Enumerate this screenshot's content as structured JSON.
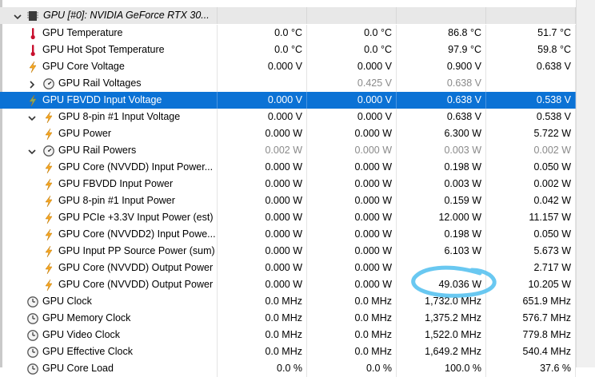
{
  "group_header": {
    "label": "GPU [#0]: NVIDIA GeForce RTX 30..."
  },
  "rows": [
    {
      "label": "GPU Temperature",
      "icon": "thermometer-icon",
      "v": [
        "0.0 °C",
        "0.0 °C",
        "86.8 °C",
        "51.7 °C"
      ]
    },
    {
      "label": "GPU Hot Spot Temperature",
      "icon": "thermometer-icon",
      "v": [
        "0.0 °C",
        "0.0 °C",
        "97.9 °C",
        "59.8 °C"
      ]
    },
    {
      "label": "GPU Core Voltage",
      "icon": "bolt-icon",
      "v": [
        "0.000 V",
        "0.000 V",
        "0.900 V",
        "0.638 V"
      ]
    },
    {
      "label": "GPU Rail Voltages",
      "icon": "gauge-icon",
      "v": [
        "",
        "0.425 V",
        "0.638 V",
        ""
      ]
    },
    {
      "label": "GPU FBVDD Input Voltage",
      "icon": "bolt-icon",
      "v": [
        "0.000 V",
        "0.000 V",
        "0.638 V",
        "0.538 V"
      ]
    },
    {
      "label": "GPU 8-pin #1 Input Voltage",
      "icon": "bolt-icon",
      "v": [
        "0.000 V",
        "0.000 V",
        "0.638 V",
        "0.538 V"
      ]
    },
    {
      "label": "GPU Power",
      "icon": "bolt-icon",
      "v": [
        "0.000 W",
        "0.000 W",
        "6.300 W",
        "5.722 W"
      ]
    },
    {
      "label": "GPU Rail Powers",
      "icon": "gauge-icon",
      "v": [
        "0.002 W",
        "0.000 W",
        "0.003 W",
        "0.002 W"
      ]
    },
    {
      "label": "GPU Core (NVVDD) Input Power...",
      "icon": "bolt-icon",
      "v": [
        "0.000 W",
        "0.000 W",
        "0.198 W",
        "0.050 W"
      ]
    },
    {
      "label": "GPU FBVDD Input Power",
      "icon": "bolt-icon",
      "v": [
        "0.000 W",
        "0.000 W",
        "0.003 W",
        "0.002 W"
      ]
    },
    {
      "label": "GPU 8-pin #1 Input Power",
      "icon": "bolt-icon",
      "v": [
        "0.000 W",
        "0.000 W",
        "0.159 W",
        "0.042 W"
      ]
    },
    {
      "label": "GPU PCIe +3.3V Input Power (est)",
      "icon": "bolt-icon",
      "v": [
        "0.000 W",
        "0.000 W",
        "12.000 W",
        "11.157 W"
      ]
    },
    {
      "label": "GPU Core (NVVDD2) Input Powe...",
      "icon": "bolt-icon",
      "v": [
        "0.000 W",
        "0.000 W",
        "0.198 W",
        "0.050 W"
      ]
    },
    {
      "label": "GPU Input PP Source Power (sum)",
      "icon": "bolt-icon",
      "v": [
        "0.000 W",
        "0.000 W",
        "6.103 W",
        "5.673 W"
      ]
    },
    {
      "label": "GPU Core (NVVDD) Output Power",
      "icon": "bolt-icon",
      "v": [
        "0.000 W",
        "0.000 W",
        "",
        "2.717 W"
      ]
    },
    {
      "label": "GPU Core (NVVDD) Output Power",
      "icon": "bolt-icon",
      "v": [
        "0.000 W",
        "0.000 W",
        "49.036 W",
        "10.205 W"
      ]
    },
    {
      "label": "GPU Clock",
      "icon": "clock-icon",
      "v": [
        "0.0 MHz",
        "0.0 MHz",
        "1,732.0 MHz",
        "651.9 MHz"
      ]
    },
    {
      "label": "GPU Memory Clock",
      "icon": "clock-icon",
      "v": [
        "0.0 MHz",
        "0.0 MHz",
        "1,375.2 MHz",
        "576.7 MHz"
      ]
    },
    {
      "label": "GPU Video Clock",
      "icon": "clock-icon",
      "v": [
        "0.0 MHz",
        "0.0 MHz",
        "1,522.0 MHz",
        "779.8 MHz"
      ]
    },
    {
      "label": "GPU Effective Clock",
      "icon": "clock-icon",
      "v": [
        "0.0 MHz",
        "0.0 MHz",
        "1,649.2 MHz",
        "540.4 MHz"
      ]
    },
    {
      "label": "GPU Core Load",
      "icon": "clock-icon",
      "v": [
        "0.0 %",
        "0.0 %",
        "100.0 %",
        "37.6 %"
      ]
    }
  ],
  "colors": {
    "selection": "#0b72d5",
    "annotation": "#59c2f0",
    "thermometer": "#c8102e",
    "bolt": "#f5a623"
  }
}
